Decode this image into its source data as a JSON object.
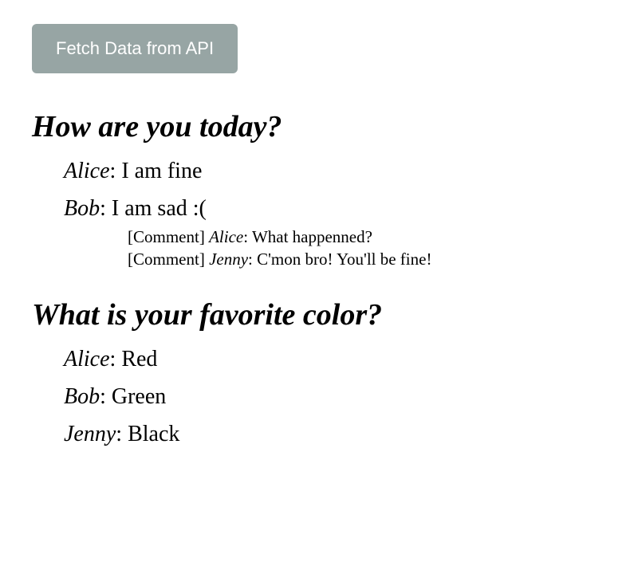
{
  "button": {
    "label": "Fetch Data from API"
  },
  "questions": [
    {
      "title": "How are you today?",
      "answers": [
        {
          "author": "Alice",
          "text": "I am fine",
          "comments": []
        },
        {
          "author": "Bob",
          "text": "I am sad :(",
          "comments": [
            {
              "prefix": "[Comment]",
              "author": "Alice",
              "text": "What happenned?"
            },
            {
              "prefix": "[Comment]",
              "author": "Jenny",
              "text": "C'mon bro! You'll be fine!"
            }
          ]
        }
      ]
    },
    {
      "title": "What is your favorite color?",
      "answers": [
        {
          "author": "Alice",
          "text": "Red",
          "comments": []
        },
        {
          "author": "Bob",
          "text": "Green",
          "comments": []
        },
        {
          "author": "Jenny",
          "text": "Black",
          "comments": []
        }
      ]
    }
  ]
}
